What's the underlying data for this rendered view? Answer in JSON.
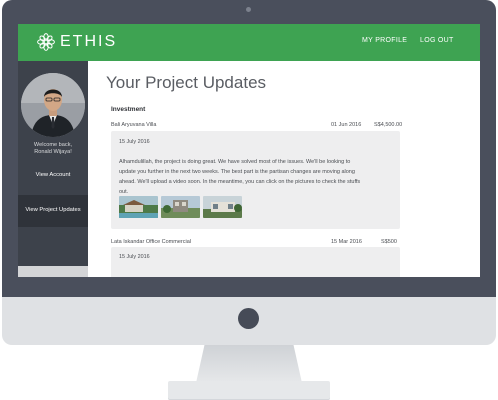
{
  "app": {
    "logo_text": "ETHIS"
  },
  "nav": {
    "my_profile": "MY PROFILE",
    "log_out": "LOG OUT"
  },
  "sidebar": {
    "welcome_line1": "Welcome back,",
    "welcome_line2": "Ronald Wijaya!",
    "view_account": "View Account",
    "view_updates": "View Project Updates"
  },
  "main": {
    "title": "Your Project Updates",
    "section": "Investment",
    "projects": [
      {
        "name": "Bali Aryuvana Villa",
        "date": "01 Jun 2016",
        "amount": "S$4,500.00",
        "update_date": "15 July 2016",
        "update_lines": [
          "Alhamdulillah, the project is doing great. We have solved most of the issues. We'll be looking to",
          "update you further in the next two weeks. The best part is the partisan changes are moving along",
          "ahead. We'll upload a video soon. In the meantime, you can click on the pictures to check the stuffs",
          "out."
        ]
      },
      {
        "name": "Lata Iskandar Office Commercial",
        "date": "15 Mar 2016",
        "amount": "S$500",
        "update_date": "15 July 2016"
      }
    ]
  },
  "colors": {
    "brand_green": "#3ea352",
    "sidebar_dark": "#3d424b",
    "bezel": "#4a4f5c"
  }
}
